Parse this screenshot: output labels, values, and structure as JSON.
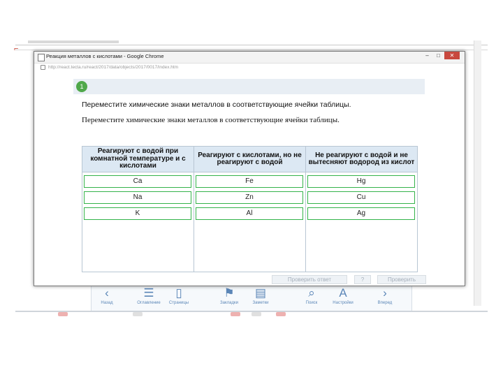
{
  "window": {
    "title": "Реакция металлов с кислотами - Google Chrome",
    "url": "http://react.tecta.ru/react/2017/data/objects/2017/0017/index.htm",
    "minimize": "–",
    "maximize": "□",
    "close": "✕"
  },
  "question": {
    "number": "1",
    "instruction": "Переместите химические знаки металлов в соответствующие ячейки таблицы.",
    "instruction_repeat": "Переместите химические знаки металлов в соответствующие ячейки таблицы."
  },
  "table": {
    "headers": [
      "Реагируют с водой при комнатной температуре и с кислотами",
      "Реагируют с кислотами, но не реагируют с водой",
      "Не реагируют с водой и не вытесняют водород из кислот"
    ],
    "columns": [
      [
        "Ca",
        "Na",
        "K"
      ],
      [
        "Fe",
        "Zn",
        "Al"
      ],
      [
        "Hg",
        "Cu",
        "Ag"
      ]
    ]
  },
  "buttons": {
    "check": "Проверить ответ",
    "help": "?",
    "next": "Проверить"
  },
  "bottom_nav": [
    {
      "icon": "chevron-left-icon",
      "glyph": "‹",
      "label": "Назад"
    },
    {
      "icon": "list-icon",
      "glyph": "☰",
      "label": "Оглавление"
    },
    {
      "icon": "book-icon",
      "glyph": "▯",
      "label": "Страницы"
    },
    {
      "icon": "bookmark-icon",
      "glyph": "⚑",
      "label": "Закладки"
    },
    {
      "icon": "notes-icon",
      "glyph": "▤",
      "label": "Заметки"
    },
    {
      "icon": "search-icon",
      "glyph": "⌕",
      "label": "Поиск"
    },
    {
      "icon": "font-settings-icon",
      "glyph": "A",
      "label": "Настройки"
    },
    {
      "icon": "chevron-right-icon",
      "glyph": "›",
      "label": "Вперед"
    }
  ],
  "colors": {
    "accent_green": "#34b34a",
    "header_blue": "#dce8f3",
    "nav_blue": "#5b86b7"
  }
}
